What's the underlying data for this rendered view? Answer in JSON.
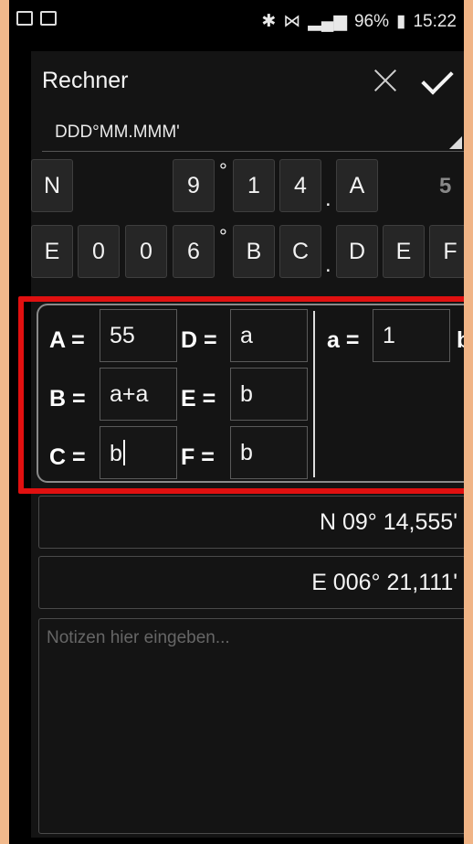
{
  "statusbar": {
    "left_icons": [
      "mail-icon",
      "image-icon"
    ],
    "battery_percent": "96%",
    "time": "15:22"
  },
  "dialog": {
    "title": "Rechner",
    "format": "DDD°MM.MMM'"
  },
  "coord_lat": {
    "cells": [
      "N",
      "9",
      "1",
      "4",
      "A"
    ],
    "hint_digit": "5",
    "deg_symbol": "°",
    "dot": "."
  },
  "coord_lon": {
    "cells": [
      "E",
      "0",
      "0",
      "6",
      "B",
      "C",
      "D",
      "E",
      "F"
    ],
    "deg_symbol": "°",
    "dot": "."
  },
  "variables": {
    "A_label": "A =",
    "A_value": "55",
    "B_label": "B =",
    "B_value": "a+a",
    "C_label": "C =",
    "C_value": "b",
    "D_label": "D =",
    "D_value": "a",
    "E_label": "E =",
    "E_value": "b",
    "F_label": "F =",
    "F_value": "b",
    "a_label": "a =",
    "a_value": "1",
    "b_label": "b"
  },
  "results": {
    "lat": "N 09° 14,555'",
    "lon": "E 006° 21,111'"
  },
  "notes": {
    "placeholder": "Notizen hier eingeben..."
  },
  "colors": {
    "highlight": "#e01010",
    "background": "#141414"
  }
}
